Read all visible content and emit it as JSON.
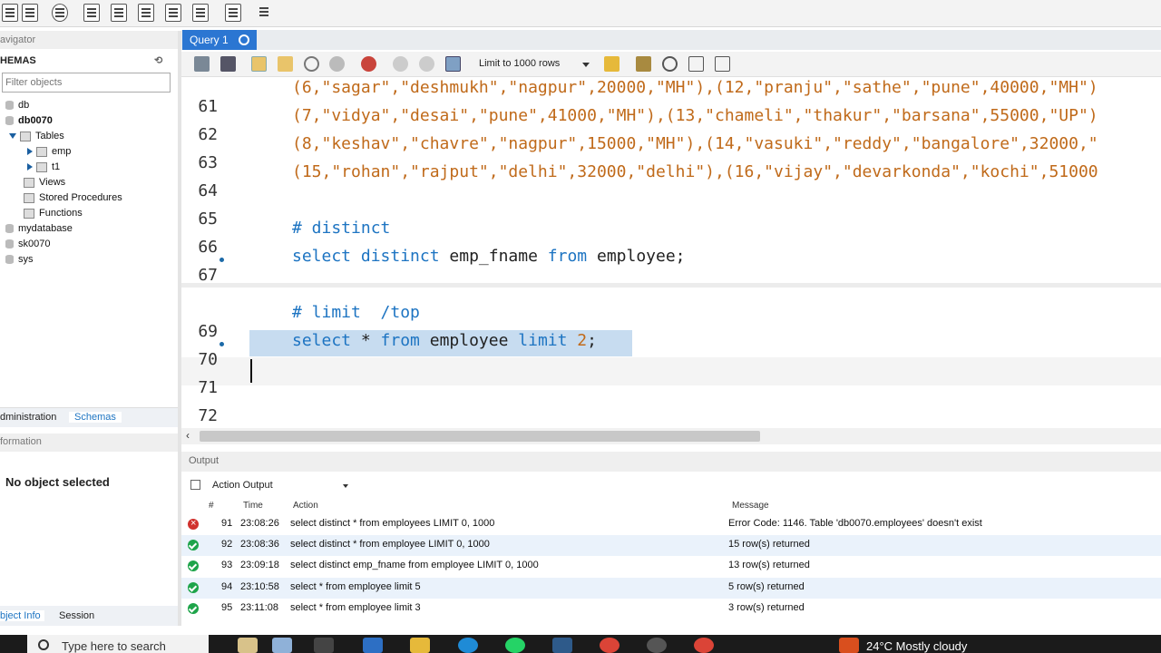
{
  "navigator": {
    "title": "avigator",
    "schemas_label": "HEMAS",
    "filter_placeholder": "Filter objects"
  },
  "schemas": [
    {
      "name": "db",
      "expanded": false
    },
    {
      "name": "db0070",
      "expanded": true,
      "bold": true
    },
    {
      "name": "mydatabase",
      "expanded": false
    },
    {
      "name": "sk0070",
      "expanded": false
    },
    {
      "name": "sys",
      "expanded": false
    }
  ],
  "db0070": {
    "tables_label": "Tables",
    "tables": [
      "emp",
      "t1"
    ],
    "views_label": "Views",
    "procedures_label": "Stored Procedures",
    "functions_label": "Functions"
  },
  "left_tabs": {
    "admin": "dministration",
    "schemas": "Schemas"
  },
  "info": {
    "title": "formation",
    "no_object": "No object selected"
  },
  "bottom_tabs": {
    "object_info": "bject Info",
    "session": "Session"
  },
  "query_tab": {
    "label": "Query 1"
  },
  "editor_toolbar": {
    "limit_label": "Limit to 1000 rows"
  },
  "editor": {
    "lines": [
      {
        "n": "61",
        "t1": "(6,\"sagar\",\"deshmukh\",\"nagpur\",20000,\"MH\"),(12,\"pranju\",\"sathe\",\"pune\",40000,\"MH\")"
      },
      {
        "n": "62",
        "t1": "(7,\"vidya\",\"desai\",\"pune\",41000,\"MH\"),(13,\"chameli\",\"thakur\",\"barsana\",55000,\"UP\")"
      },
      {
        "n": "63",
        "t1": "(8,\"keshav\",\"chavre\",\"nagpur\",15000,\"MH\"),(14,\"vasuki\",\"reddy\",\"bangalore\",32000,\""
      },
      {
        "n": "64",
        "t1": "(15,\"rohan\",\"rajput\",\"delhi\",32000,\"delhi\"),(16,\"vijay\",\"devarkonda\",\"kochi\",51000"
      },
      {
        "n": "65",
        "t1": ""
      },
      {
        "n": "66",
        "t1": "# distinct"
      },
      {
        "n": "67",
        "kw1": "select distinct",
        "id1": " emp_fname ",
        "kw2": "from",
        "id2": " employee;"
      },
      {
        "n": "69",
        "t1": "# limit  /top"
      },
      {
        "n": "70",
        "kw1": "select",
        "id1": " * ",
        "kw2": "from",
        "id2": " employee ",
        "kw3": "limit",
        "num": " 2",
        "id3": ";"
      },
      {
        "n": "71"
      },
      {
        "n": "72"
      }
    ]
  },
  "output": {
    "header": "Output",
    "type": "Action Output",
    "columns": {
      "num": "#",
      "time": "Time",
      "action": "Action",
      "message": "Message"
    },
    "rows": [
      {
        "num": "91",
        "time": "23:08:26",
        "action": "select distinct * from employees LIMIT 0, 1000",
        "message": "Error Code: 1146. Table 'db0070.employees' doesn't exist",
        "status": "error"
      },
      {
        "num": "92",
        "time": "23:08:36",
        "action": "select distinct * from employee LIMIT 0, 1000",
        "message": "15 row(s) returned",
        "status": "ok"
      },
      {
        "num": "93",
        "time": "23:09:18",
        "action": "select distinct emp_fname from employee LIMIT 0, 1000",
        "message": "13 row(s) returned",
        "status": "ok"
      },
      {
        "num": "94",
        "time": "23:10:58",
        "action": "select * from employee limit 5",
        "message": "5 row(s) returned",
        "status": "ok"
      },
      {
        "num": "95",
        "time": "23:11:08",
        "action": "select * from employee limit 3",
        "message": "3 row(s) returned",
        "status": "ok"
      }
    ]
  },
  "taskbar": {
    "search": "Type here to search",
    "weather": "24°C  Mostly cloudy"
  }
}
